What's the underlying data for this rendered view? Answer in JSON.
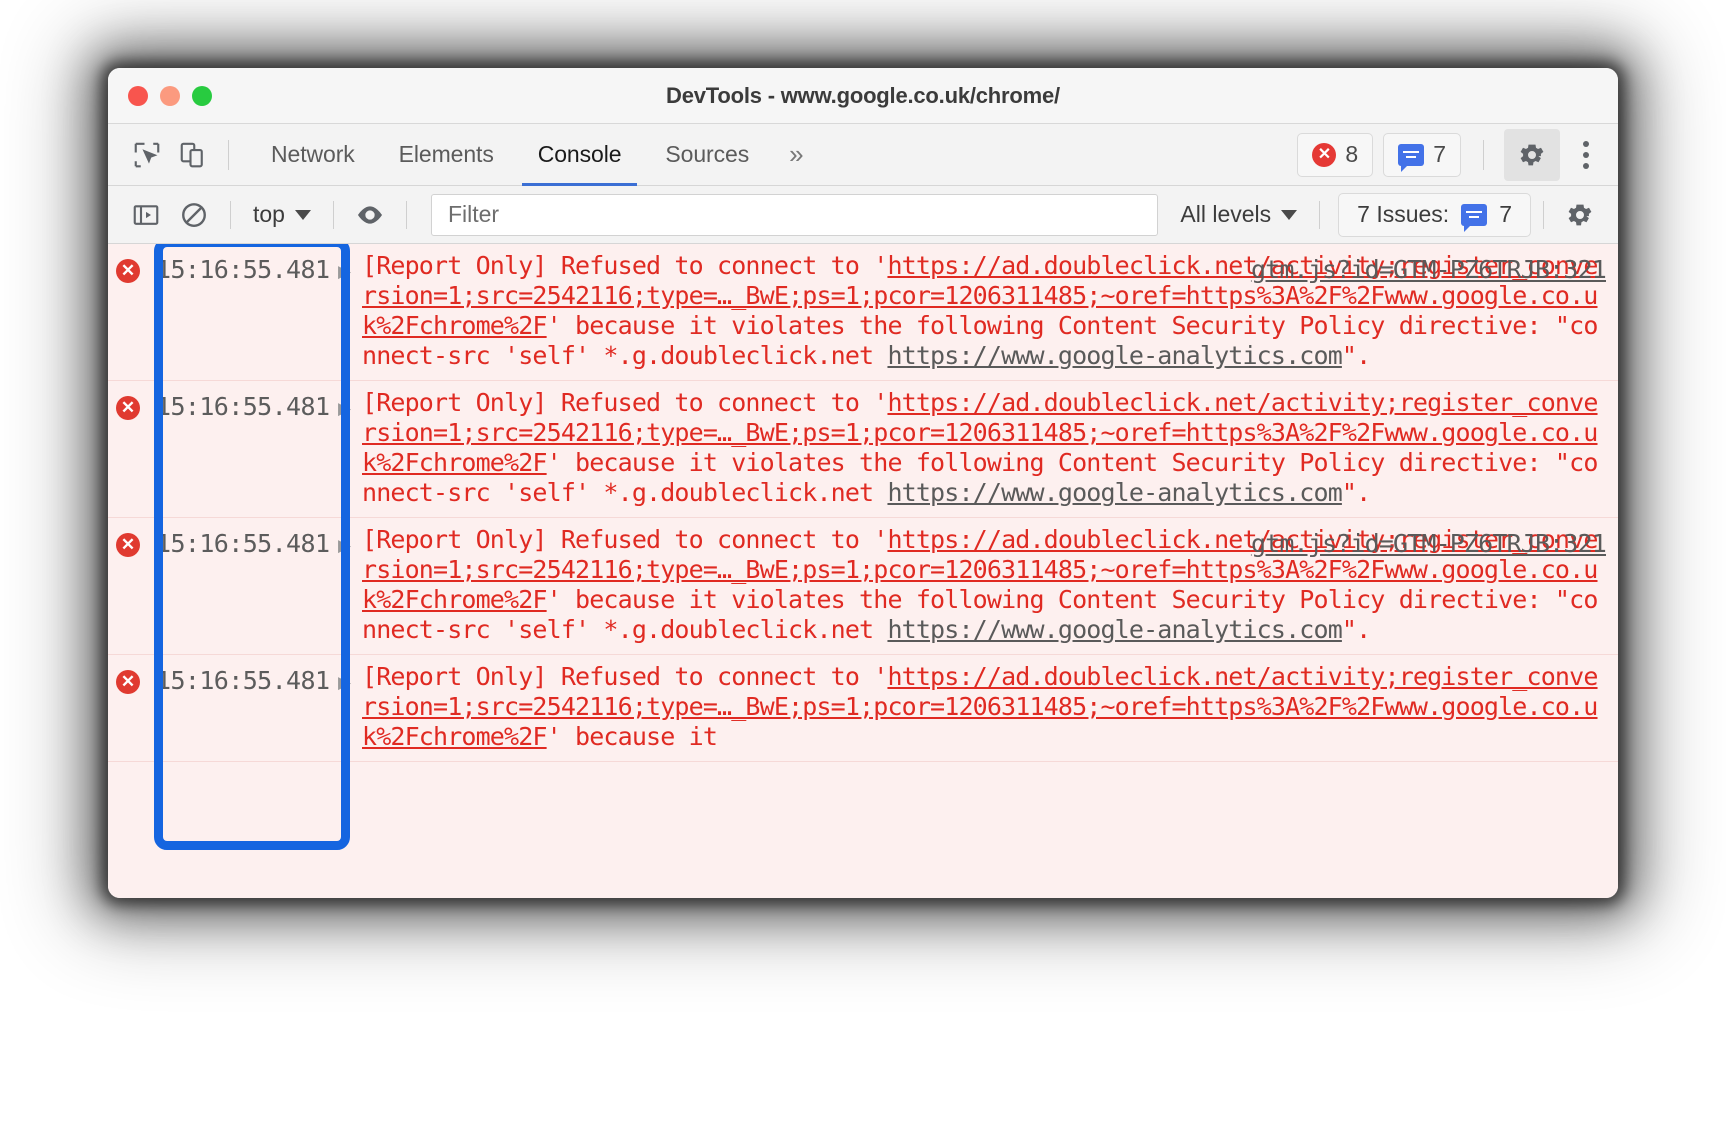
{
  "window": {
    "title": "DevTools - www.google.co.uk/chrome/",
    "traffic_lights": [
      "close",
      "minimize",
      "maximize"
    ]
  },
  "tabbar": {
    "inspect_icon": "inspect-cursor-icon",
    "device_icon": "device-toolbar-icon",
    "tabs": [
      {
        "label": "Network",
        "active": false
      },
      {
        "label": "Elements",
        "active": false
      },
      {
        "label": "Console",
        "active": true
      },
      {
        "label": "Sources",
        "active": false
      }
    ],
    "more_tabs_label": "»",
    "error_count": "8",
    "message_count": "7",
    "settings_icon": "gear-icon",
    "menu_icon": "kebab-menu-icon"
  },
  "console_toolbar": {
    "sidebar_icon": "console-sidebar-icon",
    "clear_icon": "clear-console-icon",
    "context_label": "top",
    "eye_icon": "live-expression-eye-icon",
    "filter_placeholder": "Filter",
    "filter_value": "",
    "levels_label": "All levels",
    "issues_label": "7 Issues:",
    "issues_count": "7",
    "settings_icon": "console-settings-gear-icon"
  },
  "annotation": {
    "type": "highlight-rectangle",
    "color": "#1565e0",
    "target": "timestamp-column"
  },
  "console": {
    "messages": [
      {
        "level": "error",
        "timestamp": "15:16:55.481",
        "source": "gtm.js?id=GTM-PZ6TRJB:321",
        "prefix": "[Report Only] Refused to connect to '",
        "url": "https://ad.doubleclick.net/activity;register_conversion=1;src=2542116;type=…_BwE;ps=1;pcor=1206311485;~oref=https%3A%2F%2Fwww.google.co.uk%2Fchrome%2F",
        "middle": "' because it violates the following Content Security Policy directive: \"connect-src 'self' *.g.doubleclick.net ",
        "link2": "https://www.google-analytics.com",
        "suffix": "\"."
      },
      {
        "level": "error",
        "timestamp": "15:16:55.481",
        "source": "",
        "prefix": "[Report Only] Refused to connect to '",
        "url": "https://ad.doubleclick.net/activity;register_conversion=1;src=2542116;type=…_BwE;ps=1;pcor=1206311485;~oref=https%3A%2F%2Fwww.google.co.uk%2Fchrome%2F",
        "middle": "' because it violates the following Content Security Policy directive: \"connect-src 'self' *.g.doubleclick.net ",
        "link2": "https://www.google-analytics.com",
        "suffix": "\"."
      },
      {
        "level": "error",
        "timestamp": "15:16:55.481",
        "source": "gtm.js?id=GTM-PZ6TRJB:321",
        "prefix": "[Report Only] Refused to connect to '",
        "url": "https://ad.doubleclick.net/activity;register_conversion=1;src=2542116;type=…_BwE;ps=1;pcor=1206311485;~oref=https%3A%2F%2Fwww.google.co.uk%2Fchrome%2F",
        "middle": "' because it violates the following Content Security Policy directive: \"connect-src 'self' *.g.doubleclick.net ",
        "link2": "https://www.google-analytics.com",
        "suffix": "\"."
      },
      {
        "level": "error",
        "timestamp": "15:16:55.481",
        "source": "",
        "prefix": "[Report Only] Refused to connect to '",
        "url": "https://ad.doubleclick.net/activity;register_conversion=1;src=2542116;type=…_BwE;ps=1;pcor=1206311485;~oref=https%3A%2F%2Fwww.google.co.uk%2Fchrome%2F",
        "middle": "' because it",
        "link2": "",
        "suffix": ""
      }
    ]
  },
  "colors": {
    "error_text": "#e02a22",
    "error_bg": "#fdf0ef",
    "annotation": "#1565e0",
    "accent_tab": "#3b6fd4",
    "badge_blue": "#4372e8"
  }
}
